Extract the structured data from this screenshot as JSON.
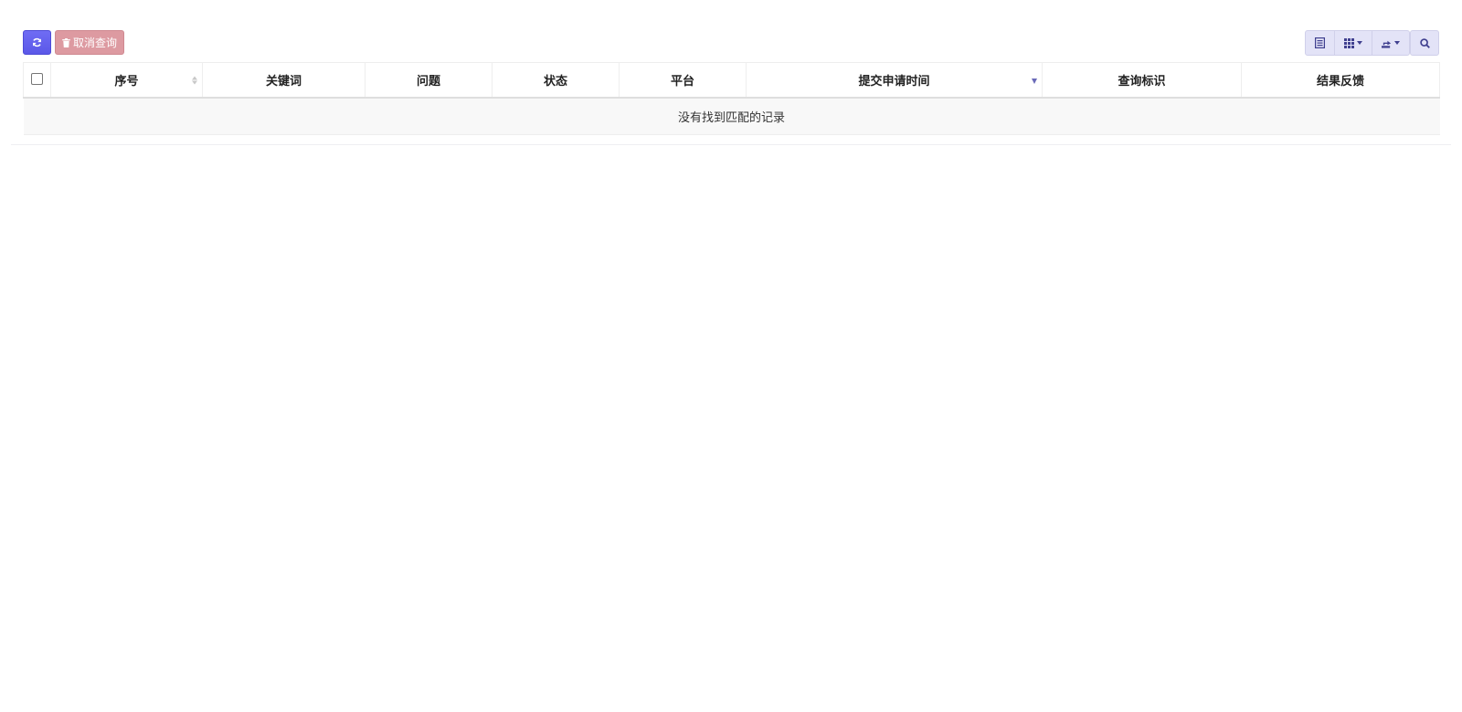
{
  "toolbar": {
    "cancel_label": "取消查询"
  },
  "table": {
    "columns": [
      {
        "label": "序号",
        "name": "col-index"
      },
      {
        "label": "关键词",
        "name": "col-keyword"
      },
      {
        "label": "问题",
        "name": "col-question"
      },
      {
        "label": "状态",
        "name": "col-status"
      },
      {
        "label": "平台",
        "name": "col-platform"
      },
      {
        "label": "提交申请时间",
        "name": "col-submit-time"
      },
      {
        "label": "查询标识",
        "name": "col-query-id"
      },
      {
        "label": "结果反馈",
        "name": "col-feedback"
      }
    ],
    "empty_message": "没有找到匹配的记录"
  },
  "colors": {
    "primary": "#5b58e8",
    "danger_disabled": "#dd9aa1",
    "light_button": "#e3e3f7",
    "sort_active": "#6a6ab8"
  },
  "icons": [
    "refresh-icon",
    "trash-icon",
    "toggle-view-icon",
    "columns-icon",
    "export-icon",
    "search-icon"
  ]
}
